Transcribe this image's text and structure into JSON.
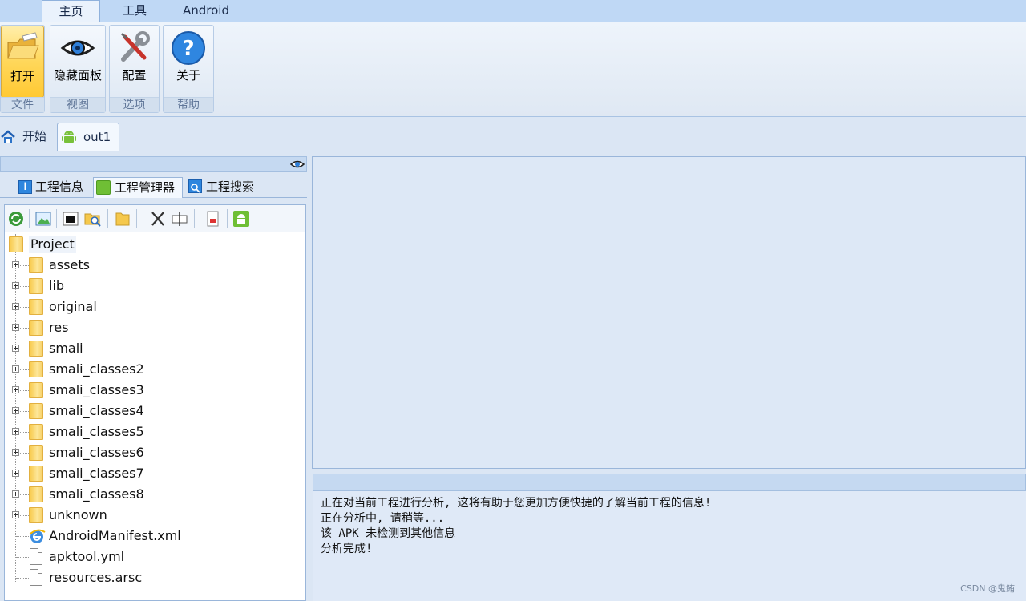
{
  "ribbon_tabs": [
    {
      "label": "主页",
      "active": true
    },
    {
      "label": "工具",
      "active": false
    },
    {
      "label": "Android",
      "active": false
    }
  ],
  "ribbon_groups": [
    {
      "button": "打开",
      "group": "文件",
      "icon": "open-folder-icon",
      "highlighted": true
    },
    {
      "button": "隐藏面板",
      "group": "视图",
      "icon": "eye-icon"
    },
    {
      "button": "配置",
      "group": "选项",
      "icon": "wrench-screwdriver-icon"
    },
    {
      "button": "关于",
      "group": "帮助",
      "icon": "question-icon"
    }
  ],
  "doc_tabs": [
    {
      "label": "开始",
      "icon": "home-icon",
      "active": false
    },
    {
      "label": "out1",
      "icon": "android-icon",
      "active": true
    }
  ],
  "left_panel": {
    "tabs": [
      {
        "label": "工程信息",
        "icon": "info-icon",
        "active": false
      },
      {
        "label": "工程管理器",
        "icon": "android-manager-icon",
        "active": true
      },
      {
        "label": "工程搜索",
        "icon": "search-icon",
        "active": false
      }
    ],
    "toolbar_icons": [
      "refresh-icon",
      "image-icon",
      "terminal-icon",
      "folder-search-icon",
      "folder-icon",
      "cut-icon",
      "rename-icon",
      "pdf-icon",
      "android-build-icon"
    ],
    "tree": {
      "root": "Project",
      "items": [
        {
          "label": "assets",
          "type": "folder"
        },
        {
          "label": "lib",
          "type": "folder"
        },
        {
          "label": "original",
          "type": "folder"
        },
        {
          "label": "res",
          "type": "folder"
        },
        {
          "label": "smali",
          "type": "folder"
        },
        {
          "label": "smali_classes2",
          "type": "folder"
        },
        {
          "label": "smali_classes3",
          "type": "folder"
        },
        {
          "label": "smali_classes4",
          "type": "folder"
        },
        {
          "label": "smali_classes5",
          "type": "folder"
        },
        {
          "label": "smali_classes6",
          "type": "folder"
        },
        {
          "label": "smali_classes7",
          "type": "folder"
        },
        {
          "label": "smali_classes8",
          "type": "folder"
        },
        {
          "label": "unknown",
          "type": "folder"
        },
        {
          "label": "AndroidManifest.xml",
          "type": "xml"
        },
        {
          "label": "apktool.yml",
          "type": "file"
        },
        {
          "label": "resources.arsc",
          "type": "file"
        }
      ]
    }
  },
  "log": {
    "lines": [
      "正在对当前工程进行分析, 这将有助于您更加方便快捷的了解当前工程的信息!",
      "正在分析中, 请稍等...",
      "该 APK 未检测到其他信息",
      "分析完成!"
    ]
  },
  "watermark": "CSDN @鬼鲔"
}
